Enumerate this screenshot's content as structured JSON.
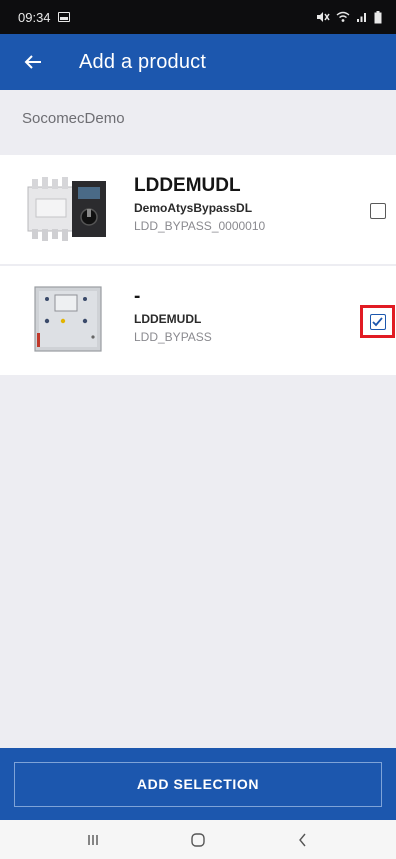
{
  "status_bar": {
    "time": "09:34",
    "icons": [
      "gallery-icon",
      "mute-icon",
      "wifi-icon",
      "signal-icon",
      "battery-icon"
    ]
  },
  "app_bar": {
    "title": "Add a product",
    "back_icon": "arrow-left-icon",
    "color": "#1c57ae"
  },
  "organization": "SocomecDemo",
  "products": [
    {
      "title": "LDDEMUDL",
      "subtitle": "DemoAtysBypassDL",
      "code": "LDD_BYPASS_0000010",
      "checked": false,
      "image": "transfer-switch-image"
    },
    {
      "title": "-",
      "subtitle": "LDDEMUDL",
      "code": "LDD_BYPASS",
      "checked": true,
      "image": "control-cabinet-image"
    }
  ],
  "actions": {
    "add_selection_label": "ADD SELECTION"
  },
  "nav_bar": {
    "icons": [
      "recent-apps-icon",
      "home-icon",
      "back-icon"
    ]
  },
  "colors": {
    "primary": "#1c57ae",
    "highlight": "#e11b23",
    "background": "#ededf2"
  }
}
